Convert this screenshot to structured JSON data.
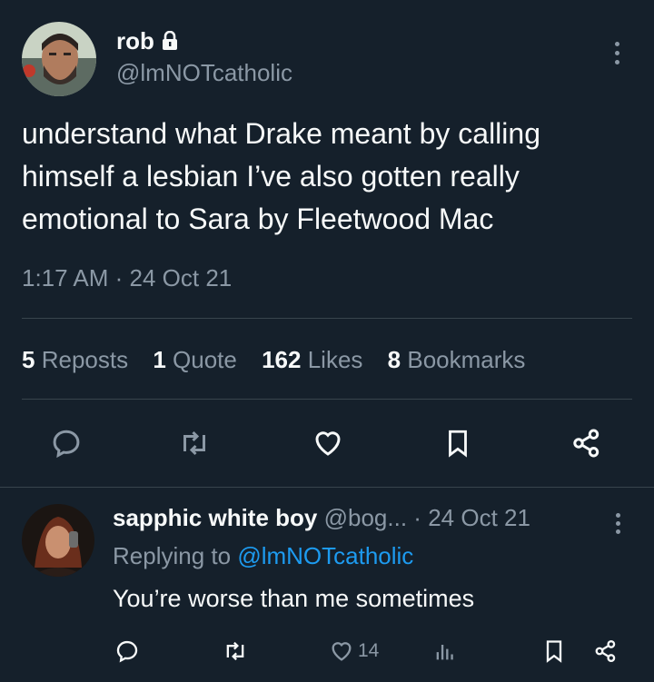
{
  "tweet": {
    "author_name": "rob",
    "handle": "@lmNOTcatholic",
    "text": "understand what Drake meant by calling himself a lesbian I’ve also gotten really emotional to Sara by Fleetwood Mac",
    "timestamp": "1:17 AM · 24 Oct 21",
    "stats": {
      "reposts_count": "5",
      "reposts_label": "Reposts",
      "quotes_count": "1",
      "quotes_label": "Quote",
      "likes_count": "162",
      "likes_label": "Likes",
      "bookmarks_count": "8",
      "bookmarks_label": "Bookmarks"
    },
    "actions": [
      "reply-icon",
      "repost-icon",
      "like-icon",
      "bookmark-icon",
      "share-icon"
    ]
  },
  "reply": {
    "author_name": "sapphic white boy",
    "handle_truncated": "@bog...",
    "separator": "·",
    "date": "24 Oct 21",
    "replying_prefix": "Replying to",
    "replying_to": "@lmNOTcatholic",
    "text": "You’re worse than me sometimes",
    "likes_count": "14",
    "actions": [
      "reply-icon",
      "repost-icon",
      "like-icon",
      "views-icon",
      "bookmark-icon",
      "share-icon"
    ]
  },
  "colors": {
    "background": "#15202b",
    "text_primary": "#f7f9f9",
    "text_secondary": "#8b98a5",
    "accent": "#1d9bf0",
    "divider": "#38444d"
  }
}
